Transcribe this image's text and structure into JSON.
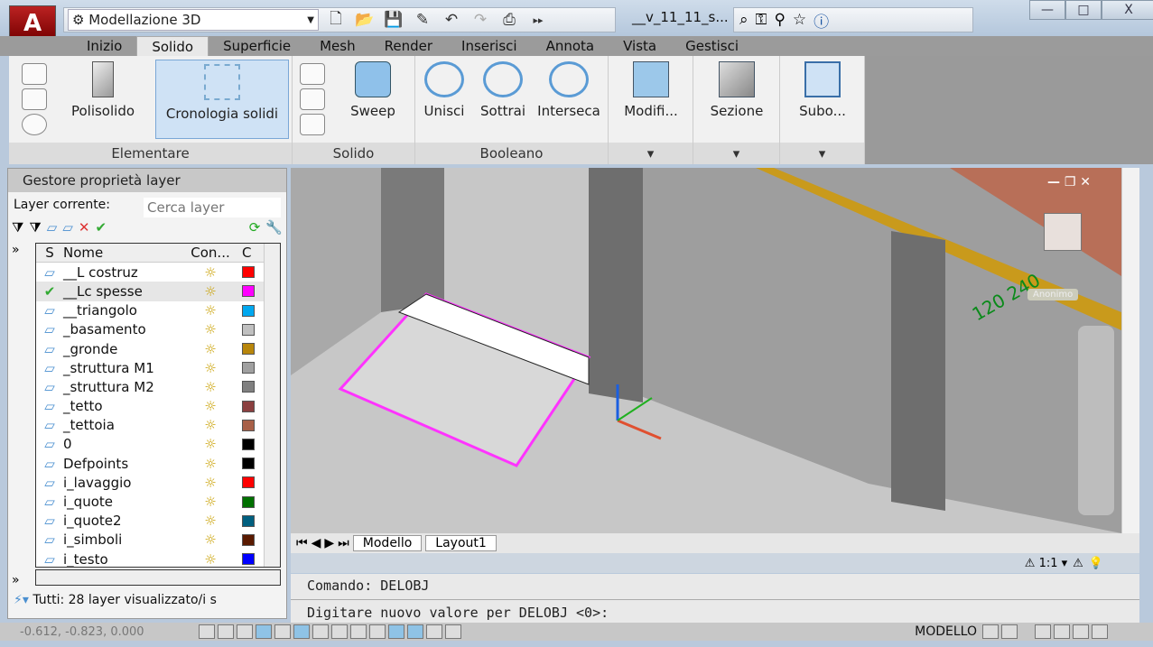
{
  "titlebar": {
    "app_logo": "A",
    "workspace": "Modellazione 3D",
    "filename": "__v_11_11_s...",
    "quick_access_icons": [
      "new-icon",
      "open-icon",
      "save-icon",
      "saveas-icon",
      "undo-icon",
      "redo-icon",
      "plot-icon",
      "more-icon"
    ],
    "info_icons": [
      "binoculars-icon",
      "key-icon",
      "satellite-icon",
      "star-icon",
      "help-icon"
    ],
    "window_controls": [
      "—",
      "□",
      "X"
    ]
  },
  "tabs": [
    {
      "label": "Inizio"
    },
    {
      "label": "Solido",
      "active": true
    },
    {
      "label": "Superficie"
    },
    {
      "label": "Mesh"
    },
    {
      "label": "Render"
    },
    {
      "label": "Inserisci"
    },
    {
      "label": "Annota"
    },
    {
      "label": "Vista"
    },
    {
      "label": "Gestisci"
    }
  ],
  "ribbon": {
    "elementare": {
      "label": "Elementare",
      "polisolido": "Polisolido",
      "cronologia": "Cronologia solidi"
    },
    "solido": {
      "label": "Solido",
      "sweep": "Sweep"
    },
    "booleano": {
      "label": "Booleano",
      "unisci": "Unisci",
      "sottrai": "Sottrai",
      "interseca": "Interseca"
    },
    "modifica": "Modifi...",
    "sezione": "Sezione",
    "subo": "Subo..."
  },
  "layer_panel": {
    "title": "Gestore proprietà layer",
    "current_label": "Layer corrente:",
    "search_placeholder": "Cerca layer",
    "columns": {
      "s": "S",
      "name": "Nome",
      "con": "Con...",
      "color": "C"
    },
    "layers": [
      {
        "name": "__L costruz",
        "color": "#ff0000"
      },
      {
        "name": "__Lc spesse",
        "color": "#ff00ff",
        "current": true
      },
      {
        "name": "__triangolo",
        "color": "#00a8f0"
      },
      {
        "name": "_basamento",
        "color": "#c0c0c0"
      },
      {
        "name": "_gronde",
        "color": "#b8860b"
      },
      {
        "name": "_struttura M1",
        "color": "#a0a0a0"
      },
      {
        "name": "_struttura M2",
        "color": "#808080"
      },
      {
        "name": "_tetto",
        "color": "#8b4040"
      },
      {
        "name": "_tettoia",
        "color": "#a86048"
      },
      {
        "name": "0",
        "color": "#000000"
      },
      {
        "name": "Defpoints",
        "color": "#000000"
      },
      {
        "name": "i_lavaggio",
        "color": "#ff0000"
      },
      {
        "name": "i_quote",
        "color": "#007000"
      },
      {
        "name": "i_quote2",
        "color": "#005f7f"
      },
      {
        "name": "i_simboli",
        "color": "#5a1a00"
      },
      {
        "name": "i_testo",
        "color": "#0000ff"
      }
    ],
    "status": "Tutti: 28 layer visualizzato/i s"
  },
  "viewport": {
    "viewcube_label": "Anonimo",
    "dimension_text": "120 240"
  },
  "layout_tabs": [
    "Modello",
    "Layout1"
  ],
  "annotation": {
    "scale": "1:1"
  },
  "command": {
    "history": "Comando: DELOBJ",
    "prompt": "Digitare nuovo valore per DELOBJ <0>:"
  },
  "statusbar": {
    "coords": "-0.612, -0.823, 0.000",
    "mode": "MODELLO"
  }
}
